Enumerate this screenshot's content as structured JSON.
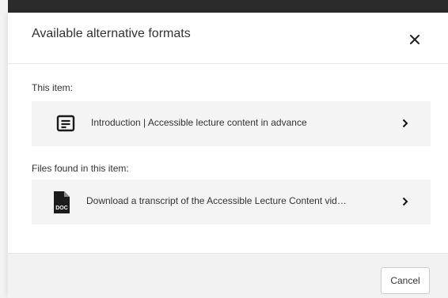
{
  "dialog": {
    "title": "Available alternative formats",
    "close_icon": "close-icon"
  },
  "this_item": {
    "label": "This item:",
    "row": {
      "icon": "page-icon",
      "text": "Introduction | Accessible lecture content in advance"
    }
  },
  "files": {
    "label": "Files found in this item:",
    "row": {
      "icon": "doc-file-icon",
      "text": "Download a transcript of the Accessible Lecture Content vid…",
      "badge": "DOC"
    }
  },
  "footer": {
    "cancel_label": "Cancel"
  },
  "colors": {
    "header_strip": "#2b2b2b",
    "row_background": "#f4f4f4",
    "footer_background": "#f2f2f2",
    "text": "#333333"
  }
}
